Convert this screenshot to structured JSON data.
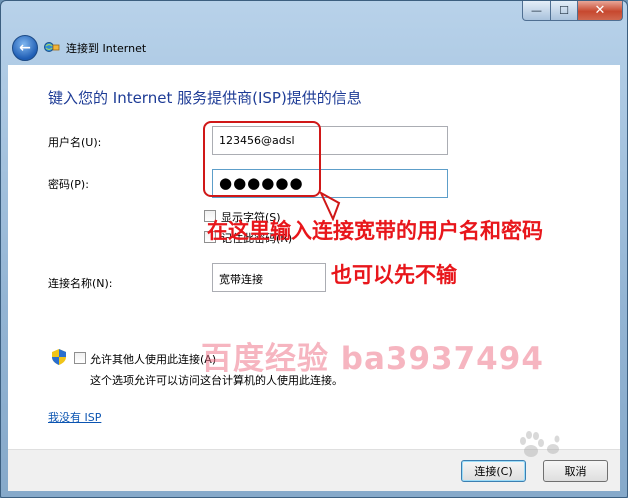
{
  "window": {
    "ghost_title": "",
    "caption": {
      "minimize": "—",
      "maximize": "☐",
      "close": "✕"
    }
  },
  "nav": {
    "back_icon": "←",
    "title": "连接到 Internet"
  },
  "main": {
    "heading": "键入您的 Internet 服务提供商(ISP)提供的信息",
    "username_label": "用户名(U):",
    "username_value": "123456@adsl",
    "password_label": "密码(P):",
    "password_value": "●●●●●●",
    "show_chars_label": "显示字符(S)",
    "remember_password_label": "记住此密码(R)",
    "connection_name_label": "连接名称(N):",
    "connection_name_value": "宽带连接",
    "allow_others_label": "允许其他人使用此连接(A)",
    "allow_others_desc": "这个选项允许可以访问这台计算机的人使用此连接。",
    "no_isp_link": "我没有 ISP"
  },
  "footer": {
    "connect_label": "连接(C)",
    "cancel_label": "取消"
  },
  "annotation": {
    "line1": "在这里输入连接宽带的用户名和密码",
    "line2": "也可以先不输",
    "color": "#e8161b"
  },
  "watermark": {
    "text": "百度经验 ba3937494"
  }
}
